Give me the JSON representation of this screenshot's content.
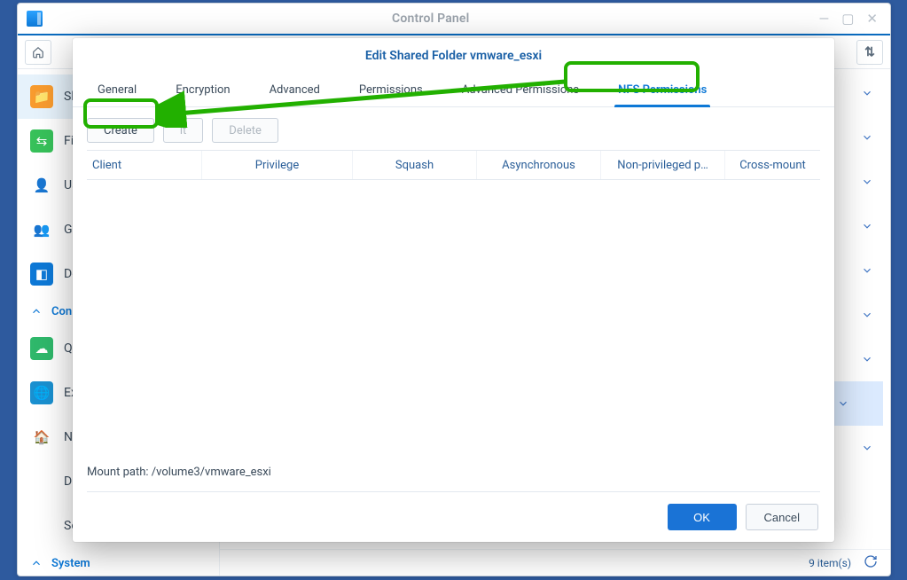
{
  "window": {
    "title": "Control Panel",
    "item_count_label": "9 item(s)"
  },
  "sidebar": {
    "section_connectivity": "Con",
    "section_system": "System",
    "items": {
      "shared_folder": "Sh",
      "file_services": "Fil",
      "user": "Us",
      "group": "Gr",
      "domain": "Do",
      "quickconnect": "Qu",
      "external": "Ex",
      "network": "Ne",
      "dhcp": "DH",
      "security": "Se"
    }
  },
  "dialog": {
    "title": "Edit Shared Folder vmware_esxi",
    "tabs": {
      "general": "General",
      "encryption": "Encryption",
      "advanced": "Advanced",
      "permissions": "Permissions",
      "adv_permissions": "Advanced Permissions",
      "nfs_permissions": "NFS Permissions"
    },
    "actions": {
      "create": "Create",
      "edit": "it",
      "delete": "Delete"
    },
    "columns": {
      "client": "Client",
      "privilege": "Privilege",
      "squash": "Squash",
      "async": "Asynchronous",
      "nonpriv": "Non-privileged p…",
      "crossmount": "Cross-mount"
    },
    "mount_path_label": "Mount path: ",
    "mount_path_value": "/volume3/vmware_esxi",
    "ok": "OK",
    "cancel": "Cancel"
  }
}
